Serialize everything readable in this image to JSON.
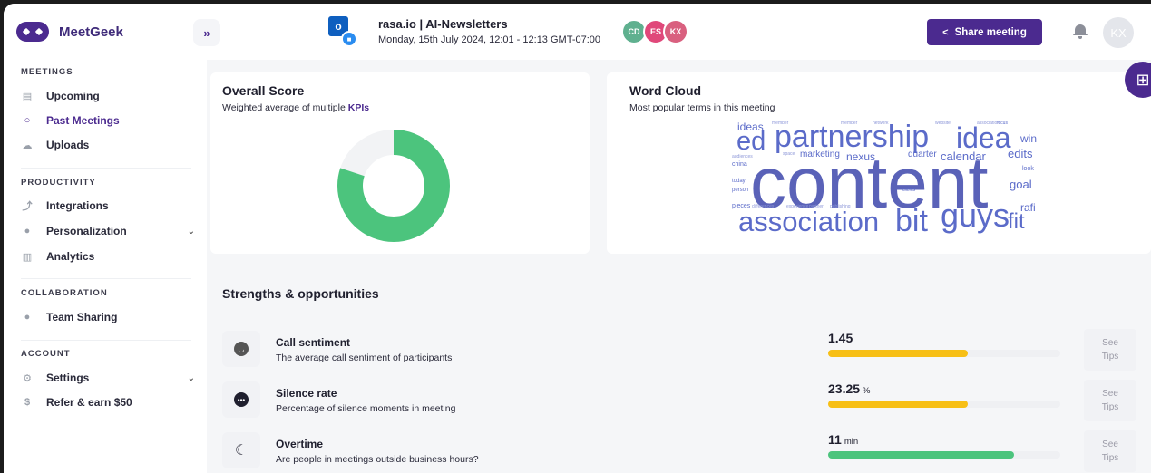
{
  "sidebar": {
    "brand": "MeetGeek",
    "sections": [
      {
        "label": "MEETINGS",
        "items": [
          {
            "label": "Upcoming"
          },
          {
            "label": "Past Meetings"
          },
          {
            "label": "Uploads"
          }
        ]
      },
      {
        "label": "PRODUCTIVITY",
        "items": [
          {
            "label": "Integrations"
          },
          {
            "label": "Personalization"
          },
          {
            "label": "Analytics"
          }
        ]
      },
      {
        "label": "COLLABORATION",
        "items": [
          {
            "label": "Team Sharing"
          }
        ]
      },
      {
        "label": "ACCOUNT",
        "items": [
          {
            "label": "Settings"
          },
          {
            "label": "Refer & earn $50"
          }
        ]
      }
    ],
    "active_item": "Past Meetings",
    "icons": {
      "upcoming": "calendar-icon",
      "past": "search-icon",
      "uploads": "upload-icon",
      "integrations": "integrations-icon",
      "personalization": "personalization-icon",
      "analytics": "analytics-icon",
      "team": "team-icon",
      "settings": "gear-icon",
      "refer": "dollar-icon"
    }
  },
  "header": {
    "expand_label": "»",
    "meeting_title": "rasa.io | AI-Newsletters",
    "meeting_date": "Monday, 15th July 2024, 12:01 - 12:13 GMT-07:00",
    "participants": [
      {
        "initials": "CD",
        "color": "#5fb08f"
      },
      {
        "initials": "ES",
        "color": "#e0487a"
      },
      {
        "initials": "KX",
        "color": "#d9607f"
      }
    ],
    "share_label": "Share meeting",
    "user_initials": "KX"
  },
  "overall_score": {
    "title": "Overall Score",
    "subtitle_prefix": "Weighted average of multiple ",
    "subtitle_link": "KPIs",
    "score_fraction": 0.8,
    "color": "#4cc47d"
  },
  "word_cloud": {
    "title": "Word Cloud",
    "subtitle": "Most popular terms in this meeting",
    "words": [
      "content",
      "partnership",
      "idea",
      "ed",
      "association",
      "bit",
      "guys",
      "fit",
      "ideas",
      "win",
      "edits",
      "marketing",
      "nexus",
      "quarter",
      "calendar",
      "china",
      "look",
      "goal",
      "rafi",
      "today",
      "person",
      "pieces",
      "clients",
      "focus",
      "association",
      "member",
      "network",
      "website",
      "space",
      "audiences",
      "differences",
      "experience",
      "partner",
      "publishing"
    ]
  },
  "strengths": {
    "title": "Strengths & opportunities",
    "tips_line1": "See",
    "tips_line2": "Tips",
    "rows": [
      {
        "name": "Call sentiment",
        "description": "The average call sentiment of participants",
        "value": "1.45",
        "unit": "",
        "fill": 0.6,
        "color": "#f7bf16"
      },
      {
        "name": "Silence rate",
        "description": "Percentage of silence moments in meeting",
        "value": "23.25",
        "unit": "%",
        "fill": 0.6,
        "color": "#f7bf16"
      },
      {
        "name": "Overtime",
        "description": "Are people in meetings outside business hours?",
        "value": "11",
        "unit": "min",
        "fill": 0.8,
        "color": "#4cc47d"
      }
    ]
  }
}
